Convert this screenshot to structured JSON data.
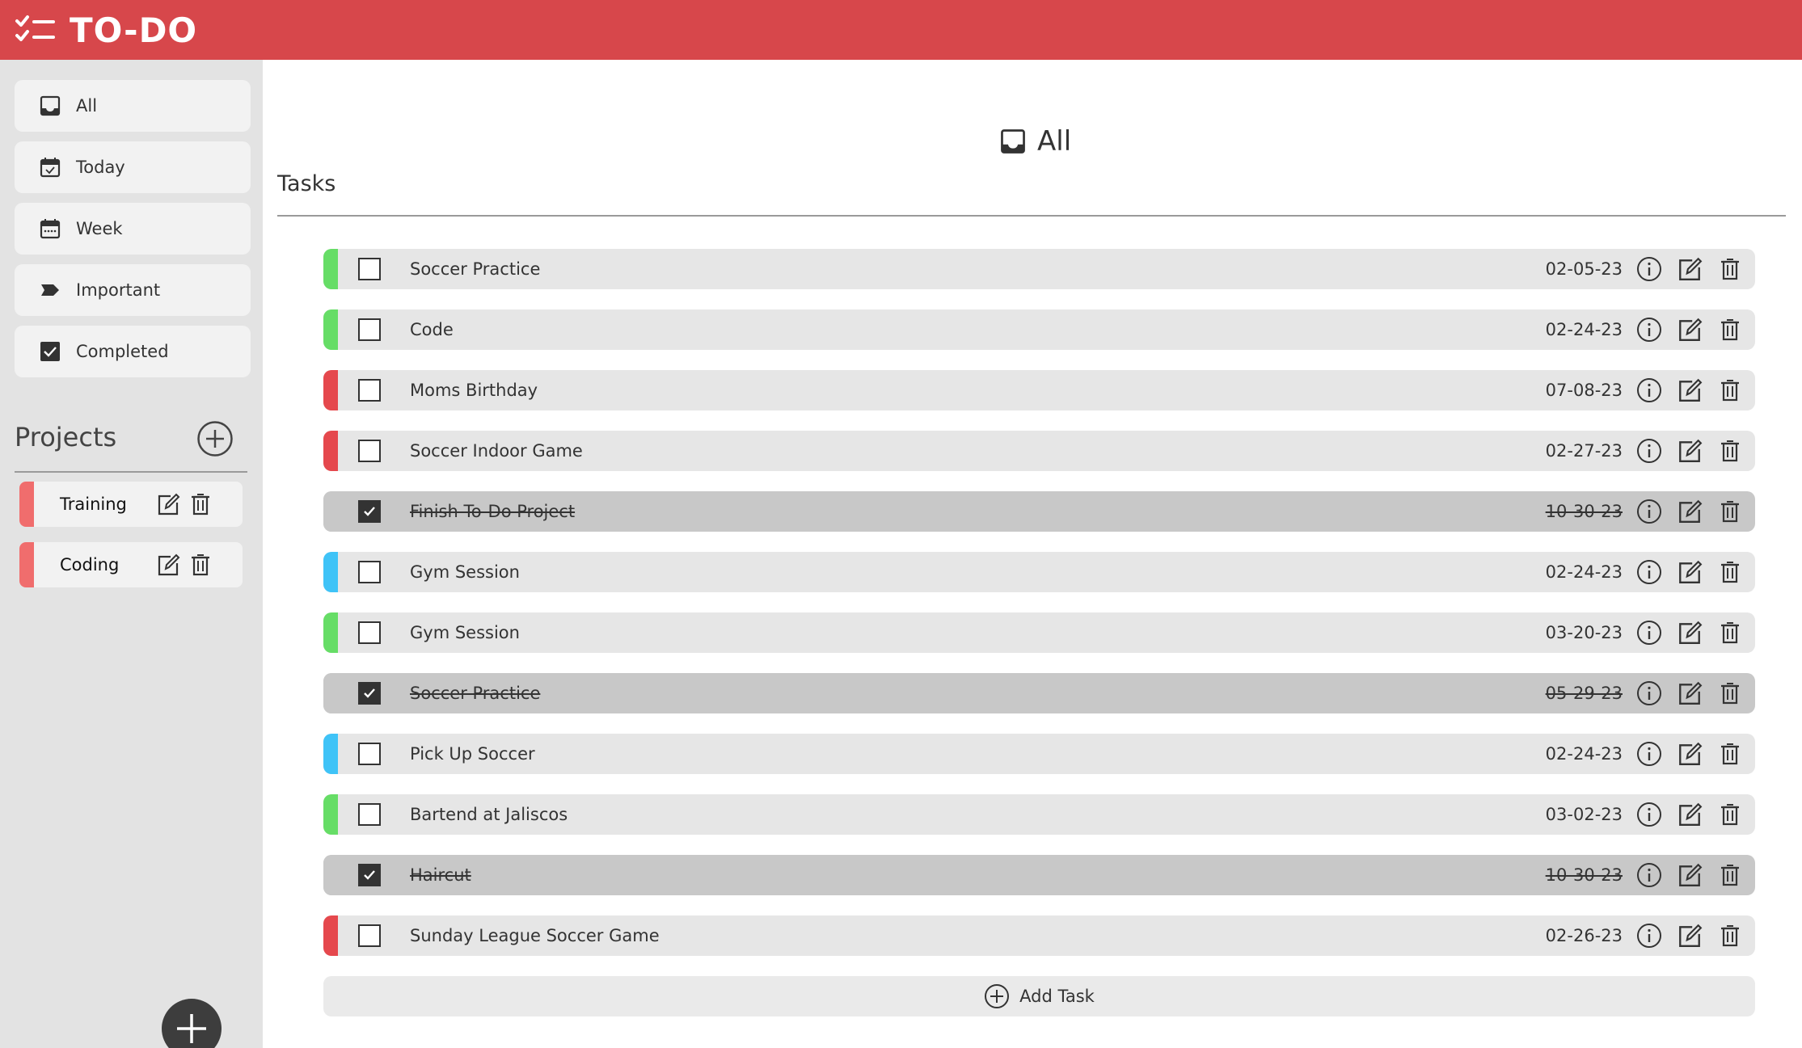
{
  "header": {
    "title": "TO-DO",
    "color": "#d7474b"
  },
  "sidebar": {
    "nav": [
      {
        "label": "All",
        "icon": "inbox-icon"
      },
      {
        "label": "Today",
        "icon": "calendar-check-icon"
      },
      {
        "label": "Week",
        "icon": "calendar-week-icon"
      },
      {
        "label": "Important",
        "icon": "label-icon"
      },
      {
        "label": "Completed",
        "icon": "checkbox-checked-icon"
      }
    ],
    "projects_title": "Projects",
    "projects": [
      {
        "label": "Training",
        "color": "#f06d6d"
      },
      {
        "label": "Coding",
        "color": "#f06d6d"
      }
    ]
  },
  "main": {
    "view_title": "All",
    "section_title": "Tasks",
    "add_task_label": "Add Task",
    "tasks": [
      {
        "name": "Soccer Practice",
        "date": "02-05-23",
        "priority_color": "#66dd66",
        "completed": false
      },
      {
        "name": "Code",
        "date": "02-24-23",
        "priority_color": "#66dd66",
        "completed": false
      },
      {
        "name": "Moms Birthday",
        "date": "07-08-23",
        "priority_color": "#e5484d",
        "completed": false
      },
      {
        "name": "Soccer Indoor Game",
        "date": "02-27-23",
        "priority_color": "#e5484d",
        "completed": false
      },
      {
        "name": "Finish To-Do Project",
        "date": "10-30-23",
        "priority_color": "#c8c8c8",
        "completed": true
      },
      {
        "name": "Gym Session",
        "date": "02-24-23",
        "priority_color": "#3fc3f7",
        "completed": false
      },
      {
        "name": "Gym Session",
        "date": "03-20-23",
        "priority_color": "#66dd66",
        "completed": false
      },
      {
        "name": "Soccer Practice",
        "date": "05-29-23",
        "priority_color": "#c8c8c8",
        "completed": true
      },
      {
        "name": "Pick Up Soccer",
        "date": "02-24-23",
        "priority_color": "#3fc3f7",
        "completed": false
      },
      {
        "name": "Bartend at Jaliscos",
        "date": "03-02-23",
        "priority_color": "#66dd66",
        "completed": false
      },
      {
        "name": "Haircut",
        "date": "10-30-23",
        "priority_color": "#c8c8c8",
        "completed": true
      },
      {
        "name": "Sunday League Soccer Game",
        "date": "02-26-23",
        "priority_color": "#e5484d",
        "completed": false
      }
    ]
  }
}
